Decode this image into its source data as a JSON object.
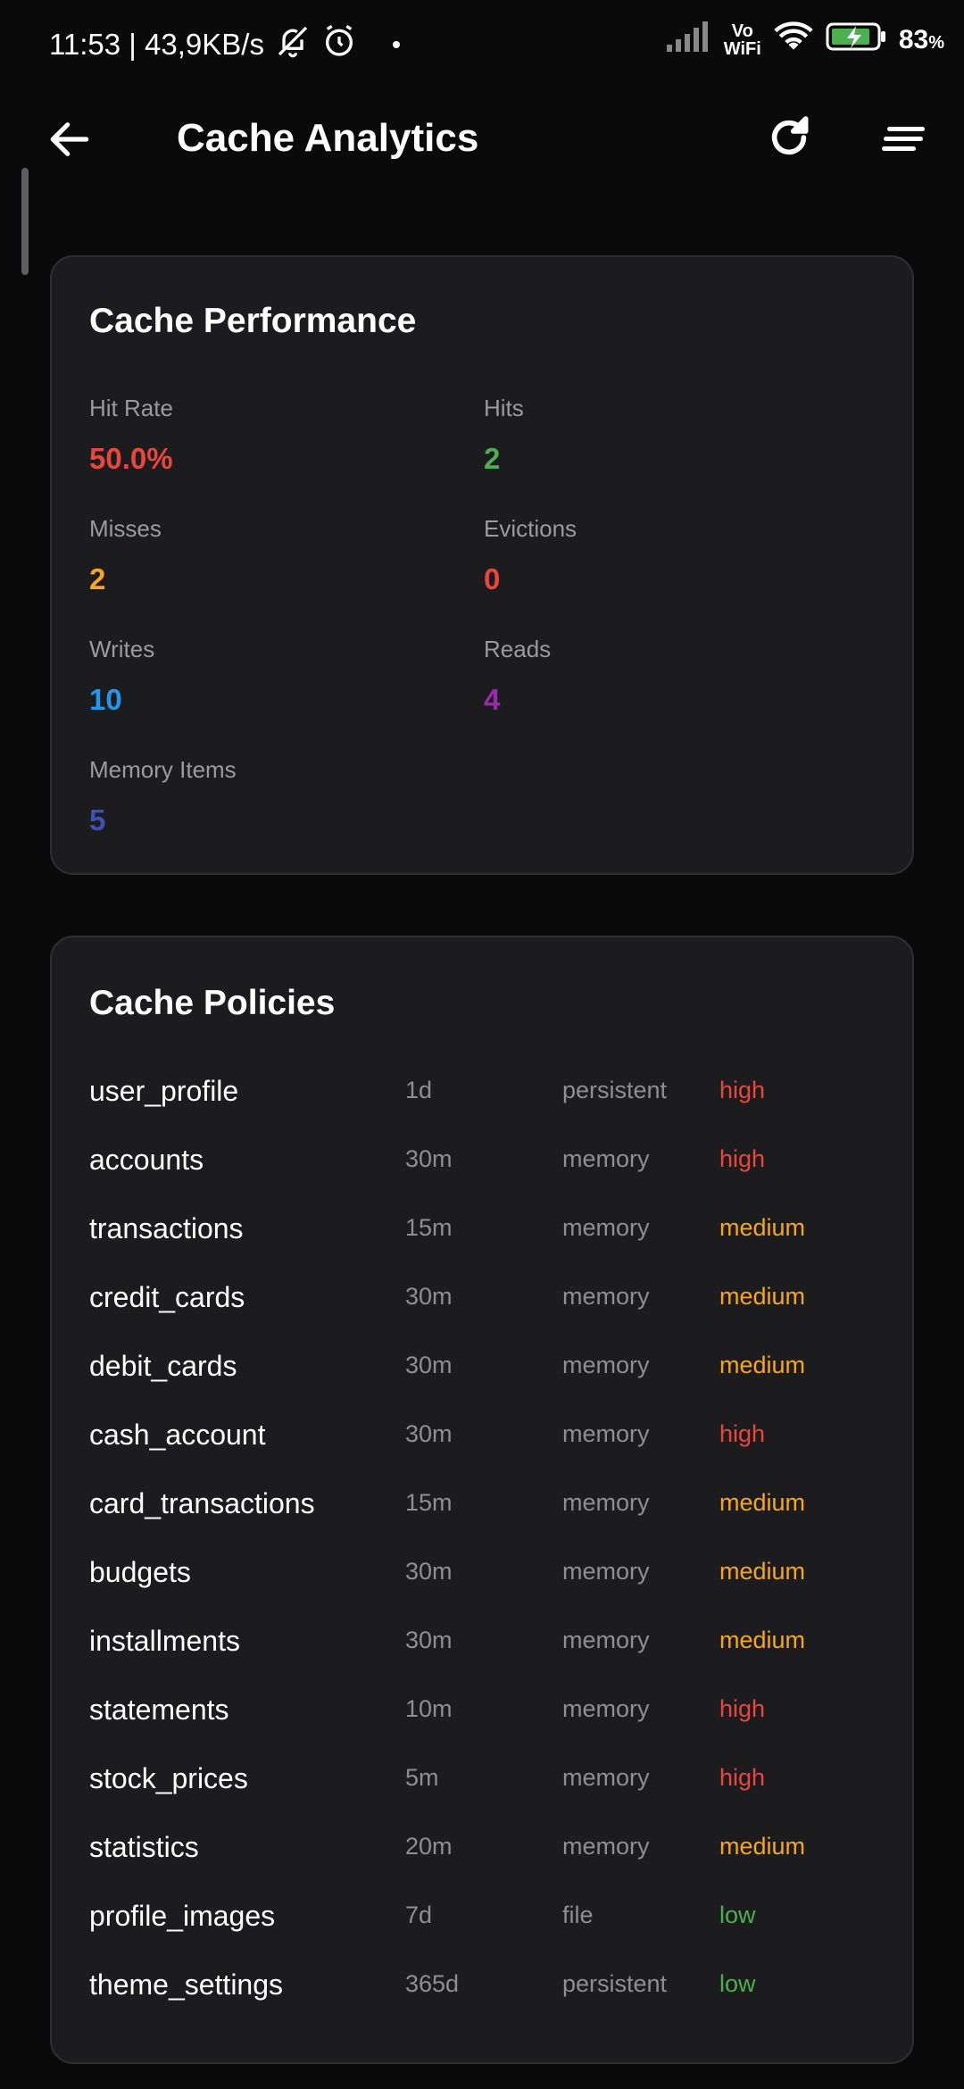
{
  "status_bar": {
    "time_speed": "11:53 | 43,9KB/s",
    "vowifi_top": "Vo",
    "vowifi_bottom": "WiFi",
    "battery": "83",
    "battery_unit": "%"
  },
  "app_bar": {
    "title": "Cache Analytics",
    "back_icon": "arrow-left-icon",
    "refresh_icon": "refresh-icon",
    "menu_icon": "sort-lines-icon"
  },
  "performance": {
    "title": "Cache Performance",
    "metrics": [
      {
        "label": "Hit Rate",
        "value": "50.0%",
        "color": "#e8473e"
      },
      {
        "label": "Hits",
        "value": "2",
        "color": "#4caf50"
      },
      {
        "label": "Misses",
        "value": "2",
        "color": "#f5a623"
      },
      {
        "label": "Evictions",
        "value": "0",
        "color": "#e8473e"
      },
      {
        "label": "Writes",
        "value": "10",
        "color": "#2196f3"
      },
      {
        "label": "Reads",
        "value": "4",
        "color": "#9c27b0"
      },
      {
        "label": "Memory Items",
        "value": "5",
        "color": "#3f51b5"
      }
    ]
  },
  "policies": {
    "title": "Cache Policies",
    "priority_colors": {
      "high": "#e8473e",
      "medium": "#f5a623",
      "low": "#4caf50"
    },
    "rows": [
      {
        "name": "user_profile",
        "ttl": "1d",
        "storage": "persistent",
        "priority": "high"
      },
      {
        "name": "accounts",
        "ttl": "30m",
        "storage": "memory",
        "priority": "high"
      },
      {
        "name": "transactions",
        "ttl": "15m",
        "storage": "memory",
        "priority": "medium"
      },
      {
        "name": "credit_cards",
        "ttl": "30m",
        "storage": "memory",
        "priority": "medium"
      },
      {
        "name": "debit_cards",
        "ttl": "30m",
        "storage": "memory",
        "priority": "medium"
      },
      {
        "name": "cash_account",
        "ttl": "30m",
        "storage": "memory",
        "priority": "high"
      },
      {
        "name": "card_transactions",
        "ttl": "15m",
        "storage": "memory",
        "priority": "medium"
      },
      {
        "name": "budgets",
        "ttl": "30m",
        "storage": "memory",
        "priority": "medium"
      },
      {
        "name": "installments",
        "ttl": "30m",
        "storage": "memory",
        "priority": "medium"
      },
      {
        "name": "statements",
        "ttl": "10m",
        "storage": "memory",
        "priority": "high"
      },
      {
        "name": "stock_prices",
        "ttl": "5m",
        "storage": "memory",
        "priority": "high"
      },
      {
        "name": "statistics",
        "ttl": "20m",
        "storage": "memory",
        "priority": "medium"
      },
      {
        "name": "profile_images",
        "ttl": "7d",
        "storage": "file",
        "priority": "low"
      },
      {
        "name": "theme_settings",
        "ttl": "365d",
        "storage": "persistent",
        "priority": "low"
      }
    ]
  }
}
